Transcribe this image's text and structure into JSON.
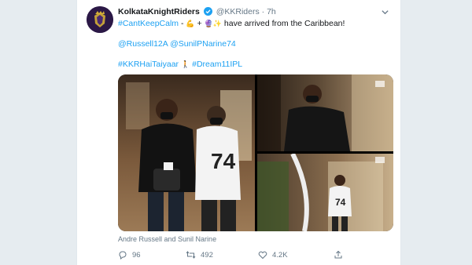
{
  "tweet": {
    "author_name": "KolkataKnightRiders",
    "author_handle": "@KKRiders",
    "separator": "·",
    "time": "7h",
    "text": {
      "hashtag_calm": "#CantKeepCalm",
      "dash": " - ",
      "plus": " + ",
      "arrived": " have arrived from the Caribbean!",
      "mention_russell": "@Russell12A",
      "mention_narine": "@SunilPNarine74",
      "hashtag_kkr": "#KKRHaiTaiyaar",
      "hashtag_dream": "#Dream11IPL"
    },
    "emojis": {
      "muscle": "💪",
      "crystal_ball": "🔮",
      "sparkles": "✨",
      "walking": "🚶"
    },
    "media_caption": "Andre Russell and Sunil Narine",
    "actions": {
      "reply_count": "96",
      "retweet_count": "492",
      "like_count": "4.2K"
    }
  },
  "colors": {
    "link": "#1da1f2",
    "muted": "#657786",
    "verified": "#1da1f2",
    "brand_purple": "#2b1846",
    "brand_gold": "#d4af37"
  },
  "icons": [
    "kkr-logo-icon",
    "verified-badge-icon",
    "caret-down-icon",
    "reply-icon",
    "retweet-icon",
    "like-icon",
    "share-icon"
  ]
}
